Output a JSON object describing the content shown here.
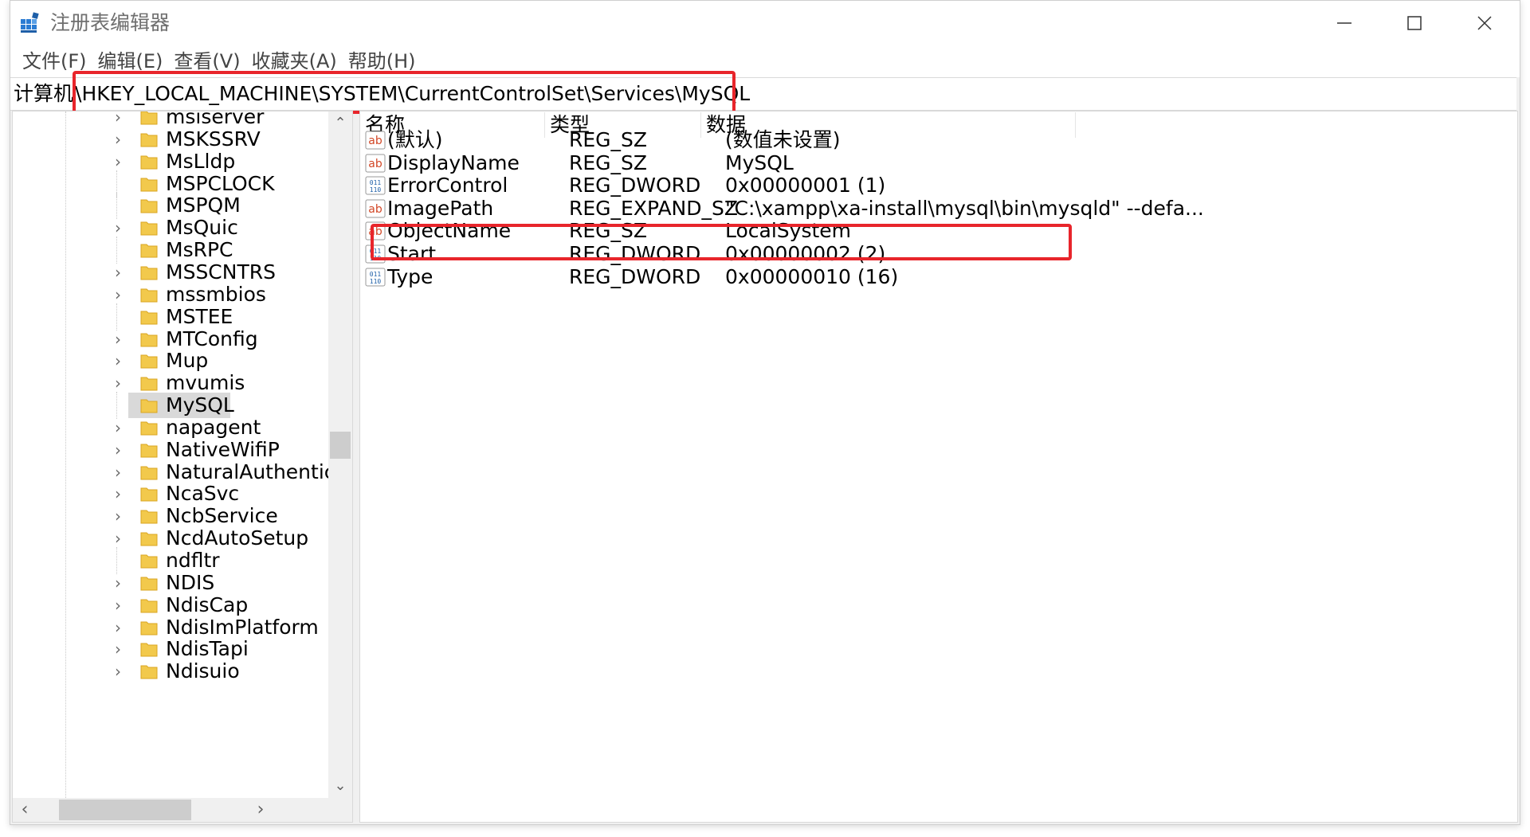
{
  "window": {
    "title": "注册表编辑器",
    "controls": {
      "minimize": "minimize-icon",
      "maximize": "maximize-icon",
      "close": "close-icon"
    }
  },
  "menu": [
    "文件(F)",
    "编辑(E)",
    "查看(V)",
    "收藏夹(A)",
    "帮助(H)"
  ],
  "address": {
    "root": "计算机",
    "path": "\\HKEY_LOCAL_MACHINE\\SYSTEM\\CurrentControlSet\\Services\\MySQL"
  },
  "tree": {
    "items": [
      {
        "label": "msiserver",
        "expandable": true
      },
      {
        "label": "MSKSSRV",
        "expandable": true
      },
      {
        "label": "MsLldp",
        "expandable": true
      },
      {
        "label": "MSPCLOCK",
        "expandable": false
      },
      {
        "label": "MSPQM",
        "expandable": false
      },
      {
        "label": "MsQuic",
        "expandable": true
      },
      {
        "label": "MsRPC",
        "expandable": false
      },
      {
        "label": "MSSCNTRS",
        "expandable": true
      },
      {
        "label": "mssmbios",
        "expandable": true
      },
      {
        "label": "MSTEE",
        "expandable": false
      },
      {
        "label": "MTConfig",
        "expandable": true
      },
      {
        "label": "Mup",
        "expandable": true
      },
      {
        "label": "mvumis",
        "expandable": true
      },
      {
        "label": "MySQL",
        "expandable": false,
        "selected": true
      },
      {
        "label": "napagent",
        "expandable": true
      },
      {
        "label": "NativeWifiP",
        "expandable": true
      },
      {
        "label": "NaturalAuthentica",
        "expandable": true
      },
      {
        "label": "NcaSvc",
        "expandable": true
      },
      {
        "label": "NcbService",
        "expandable": true
      },
      {
        "label": "NcdAutoSetup",
        "expandable": true
      },
      {
        "label": "ndfltr",
        "expandable": false
      },
      {
        "label": "NDIS",
        "expandable": true
      },
      {
        "label": "NdisCap",
        "expandable": true
      },
      {
        "label": "NdisImPlatform",
        "expandable": true
      },
      {
        "label": "NdisTapi",
        "expandable": true
      },
      {
        "label": "Ndisuio",
        "expandable": true
      }
    ]
  },
  "list": {
    "headers": {
      "name": "名称",
      "type": "类型",
      "data": "数据"
    },
    "rows": [
      {
        "icon": "string-value-icon",
        "name": "(默认)",
        "type": "REG_SZ",
        "data": "(数值未设置)"
      },
      {
        "icon": "string-value-icon",
        "name": "DisplayName",
        "type": "REG_SZ",
        "data": "MySQL"
      },
      {
        "icon": "binary-value-icon",
        "name": "ErrorControl",
        "type": "REG_DWORD",
        "data": "0x00000001 (1)"
      },
      {
        "icon": "string-value-icon",
        "name": "ImagePath",
        "type": "REG_EXPAND_SZ",
        "data": "\"C:\\xampp\\xa-install\\mysql\\bin\\mysqld\" --defa..."
      },
      {
        "icon": "string-value-icon",
        "name": "ObjectName",
        "type": "REG_SZ",
        "data": "LocalSystem"
      },
      {
        "icon": "binary-value-icon",
        "name": "Start",
        "type": "REG_DWORD",
        "data": "0x00000002 (2)"
      },
      {
        "icon": "binary-value-icon",
        "name": "Type",
        "type": "REG_DWORD",
        "data": "0x00000010 (16)"
      }
    ]
  },
  "colors": {
    "highlight_border": "#e8252b",
    "folder": "#f2c94c",
    "selection": "#d9d9d9"
  }
}
